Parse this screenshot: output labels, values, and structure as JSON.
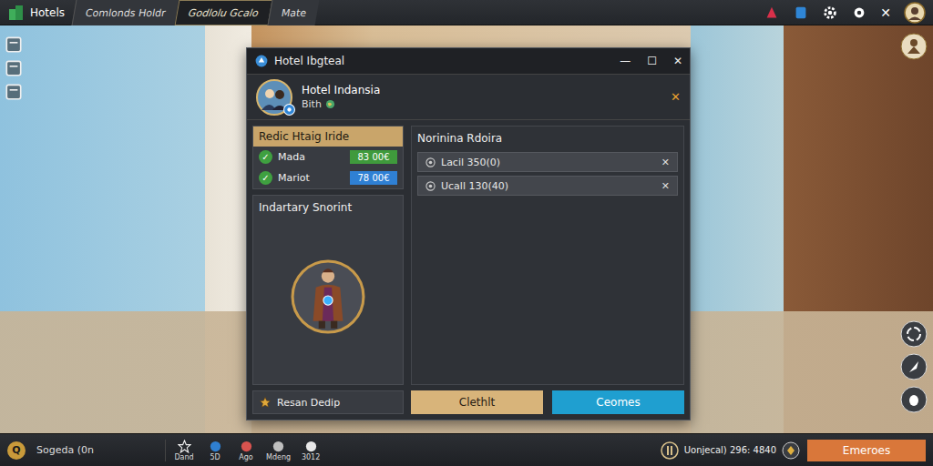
{
  "top_bar": {
    "app_name": "Hotels",
    "tabs": [
      {
        "label": "Comlonds Holdr",
        "selected": false
      },
      {
        "label": "Godlolu Gcalo",
        "selected": true
      },
      {
        "label": "Mate",
        "selected": false
      }
    ],
    "close": "✕"
  },
  "dialog": {
    "title": "Hotel Ibgteal",
    "controls": [
      "—",
      "☐",
      "✕"
    ],
    "hotel_name": "Hotel Indansia",
    "hotel_sub": "Bith",
    "close": "✕"
  },
  "rate_panel": {
    "title": "Redic Htaig Iride",
    "rows": [
      {
        "label": "Mada",
        "checked": true,
        "check": "✓",
        "price": "83 00€",
        "color": "#3f9a3c"
      },
      {
        "label": "Mariot",
        "checked": true,
        "check": "✓",
        "price": "78 00€",
        "color": "#2f80d4"
      }
    ]
  },
  "inventory": {
    "title": "Indartary Snorint"
  },
  "footer_left": {
    "label": "Resan Dedip"
  },
  "requests": {
    "title": "Norinina Rdoira",
    "items": [
      {
        "label": "Lacil 350(0)",
        "remove": "✕"
      },
      {
        "label": "Ucall 130(40)",
        "remove": "✕"
      }
    ]
  },
  "buttons": [
    {
      "label": "Clethlt",
      "kind": "secondary"
    },
    {
      "label": "Ceomes",
      "kind": "primary"
    }
  ],
  "bottom_bar": {
    "search_icon": "Q",
    "search": "Sogeda (0n",
    "items": [
      {
        "label": "Dand"
      },
      {
        "label": "5D"
      },
      {
        "label": "Ago"
      },
      {
        "label": "Mdeng"
      },
      {
        "label": "3012"
      }
    ],
    "currency": "Uonjecal) 296: 4840",
    "action": "Emeroes"
  }
}
